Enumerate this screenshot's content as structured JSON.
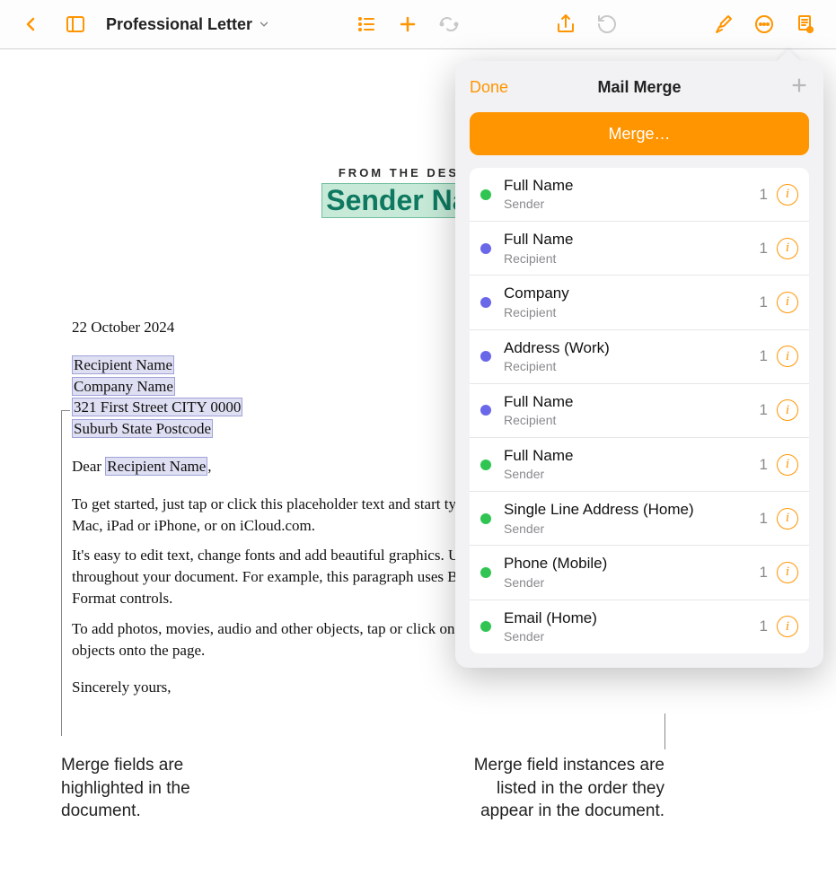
{
  "toolbar": {
    "doc_title": "Professional Letter"
  },
  "popover": {
    "done": "Done",
    "title": "Mail Merge",
    "merge_btn": "Merge…",
    "fields": [
      {
        "name": "Full Name",
        "role": "Sender",
        "count": "1",
        "color": "green"
      },
      {
        "name": "Full Name",
        "role": "Recipient",
        "count": "1",
        "color": "purple"
      },
      {
        "name": "Company",
        "role": "Recipient",
        "count": "1",
        "color": "purple"
      },
      {
        "name": "Address (Work)",
        "role": "Recipient",
        "count": "1",
        "color": "purple"
      },
      {
        "name": "Full Name",
        "role": "Recipient",
        "count": "1",
        "color": "purple"
      },
      {
        "name": "Full Name",
        "role": "Sender",
        "count": "1",
        "color": "green"
      },
      {
        "name": "Single Line Address (Home)",
        "role": "Sender",
        "count": "1",
        "color": "green"
      },
      {
        "name": "Phone (Mobile)",
        "role": "Sender",
        "count": "1",
        "color": "green"
      },
      {
        "name": "Email (Home)",
        "role": "Sender",
        "count": "1",
        "color": "green"
      }
    ]
  },
  "document": {
    "from_desk": "FROM THE DESK OF",
    "sender_name": "Sender Name",
    "date": "22 October 2024",
    "recipient_name": "Recipient Name",
    "company_name": "Company Name",
    "address_line1": "321 First Street CITY 0000",
    "address_line2": "Suburb State Postcode",
    "salutation_prefix": "Dear ",
    "salutation_name": "Recipient Name",
    "salutation_suffix": ",",
    "para1": "To get started, just tap or click this placeholder text and start typing. You can also edit this document on your Mac, iPad or iPhone, or on iCloud.com.",
    "para2": "It's easy to edit text, change fonts and add beautiful graphics. Use paragraph styles to get a consistent look throughout your document. For example, this paragraph uses Body style. You can change it in the Text tab of the Format controls.",
    "para3": "To add photos, movies, audio and other objects, tap or click one of the buttons in the toolbar or drag and drop the objects onto the page.",
    "closing": "Sincerely yours,"
  },
  "callouts": {
    "left": "Merge fields are highlighted in the document.",
    "right": "Merge field instances are listed in the order they appear in the document."
  }
}
